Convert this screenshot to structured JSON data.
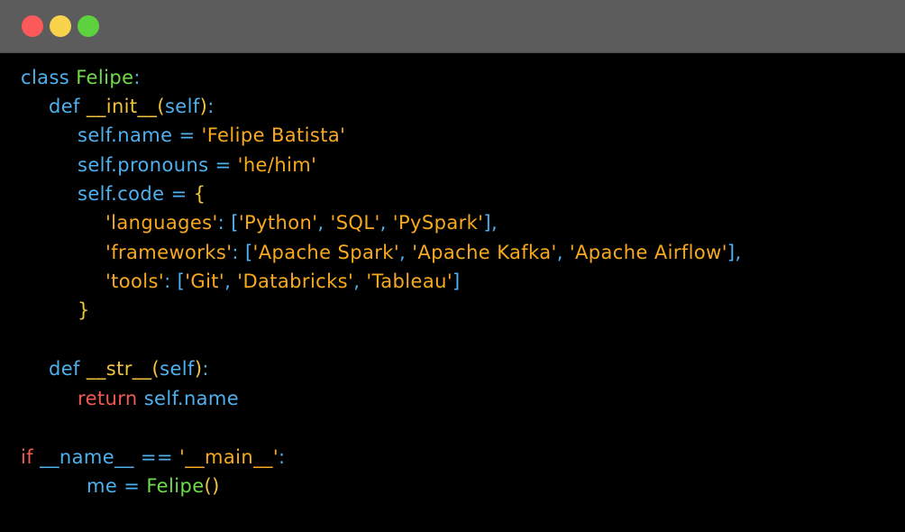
{
  "window": {
    "controls": [
      {
        "name": "close",
        "color": "#fc5a5a"
      },
      {
        "name": "minimize",
        "color": "#f9d34c"
      },
      {
        "name": "maximize",
        "color": "#5ed23e"
      }
    ]
  },
  "colors": {
    "titlebar": "#5c5c5c",
    "background": "#000000",
    "keyword": "#4fb0ee",
    "class_name": "#6fdc4b",
    "function_name": "#f2c33e",
    "string": "#f8a91e",
    "return_keyword": "#f05a52"
  },
  "code": {
    "l1_kw": "class",
    "l1_name": "Felipe",
    "l1_colon": ":",
    "l2_def": "def",
    "l2_fn": "__init__",
    "l2_open": "(",
    "l2_self": "self",
    "l2_close": ")",
    "l2_colon": ":",
    "l3_attr": "self.name",
    "l3_eq": "=",
    "l3_val": "'Felipe Batista'",
    "l4_attr": "self.pronouns",
    "l4_eq": "=",
    "l4_val": "'he/him'",
    "l5_attr": "self.code",
    "l5_eq": "=",
    "l5_brace": "{",
    "l6_key": "'languages'",
    "l6_colon": ":",
    "l6_open": "[",
    "l6_v1": "'Python'",
    "l6_c1": ",",
    "l6_v2": "'SQL'",
    "l6_c2": ",",
    "l6_v3": "'PySpark'",
    "l6_close": "]",
    "l6_comma": ",",
    "l7_key": "'frameworks'",
    "l7_colon": ":",
    "l7_open": "[",
    "l7_v1": "'Apache Spark'",
    "l7_c1": ",",
    "l7_v2": "'Apache Kafka'",
    "l7_c2": ",",
    "l7_v3": "'Apache Airflow'",
    "l7_close": "]",
    "l7_comma": ",",
    "l8_key": "'tools'",
    "l8_colon": ":",
    "l8_open": "[",
    "l8_v1": "'Git'",
    "l8_c1": ",",
    "l8_v2": "'Databricks'",
    "l8_c2": ",",
    "l8_v3": "'Tableau'",
    "l8_close": "]",
    "l9_brace": "}",
    "l11_def": "def",
    "l11_fn": "__str__",
    "l11_open": "(",
    "l11_self": "self",
    "l11_close": ")",
    "l11_colon": ":",
    "l12_ret": "return",
    "l12_val": "self.name",
    "l14_if": "if",
    "l14_name": "__name__",
    "l14_eq": "==",
    "l14_str": "'__main__'",
    "l14_colon": ":",
    "l15_var": "me",
    "l15_eq": "=",
    "l15_cls": "Felipe",
    "l15_paren": "()"
  }
}
